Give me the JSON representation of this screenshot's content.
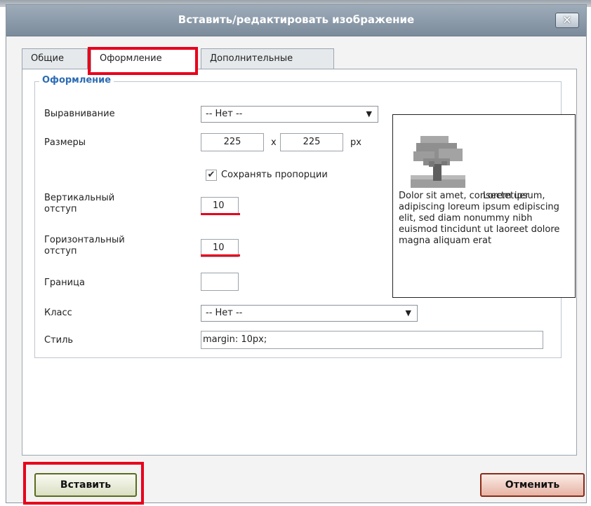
{
  "dialog": {
    "title": "Вставить/редактировать изображение",
    "close_label": "✕"
  },
  "tabs": [
    {
      "label": "Общие",
      "active": false
    },
    {
      "label": "Оформление",
      "active": true
    },
    {
      "label": "Дополнительные",
      "active": false
    }
  ],
  "section": {
    "legend": "Оформление"
  },
  "fields": {
    "alignment": {
      "label": "Выравнивание",
      "value": "-- Нет --"
    },
    "size": {
      "label": "Размеры",
      "width": "225",
      "separator": "x",
      "height": "225",
      "unit": "px"
    },
    "keep_proportions": {
      "label": "Сохранять пропорции",
      "checked": true,
      "check_glyph": "✔"
    },
    "vspace": {
      "label": "Вертикальный отступ",
      "value": "10"
    },
    "hspace": {
      "label": "Горизонтальный отступ",
      "value": "10"
    },
    "border": {
      "label": "Граница",
      "value": ""
    },
    "class": {
      "label": "Класс",
      "value": "-- Нет --"
    },
    "style": {
      "label": "Стиль",
      "value": "margin: 10px;"
    }
  },
  "preview": {
    "first_line": "Lorem ipsum,",
    "text": "Dolor sit amet, consectetuer adipiscing loreum ipsum edipiscing elit, sed diam nonummy nibh euismod tincidunt ut laoreet dolore magna aliquam erat"
  },
  "buttons": {
    "insert": "Вставить",
    "cancel": "Отменить"
  },
  "colors": {
    "highlight": "#e8001c",
    "legend": "#2c6cb4",
    "titlebar": "#8e9cab"
  }
}
